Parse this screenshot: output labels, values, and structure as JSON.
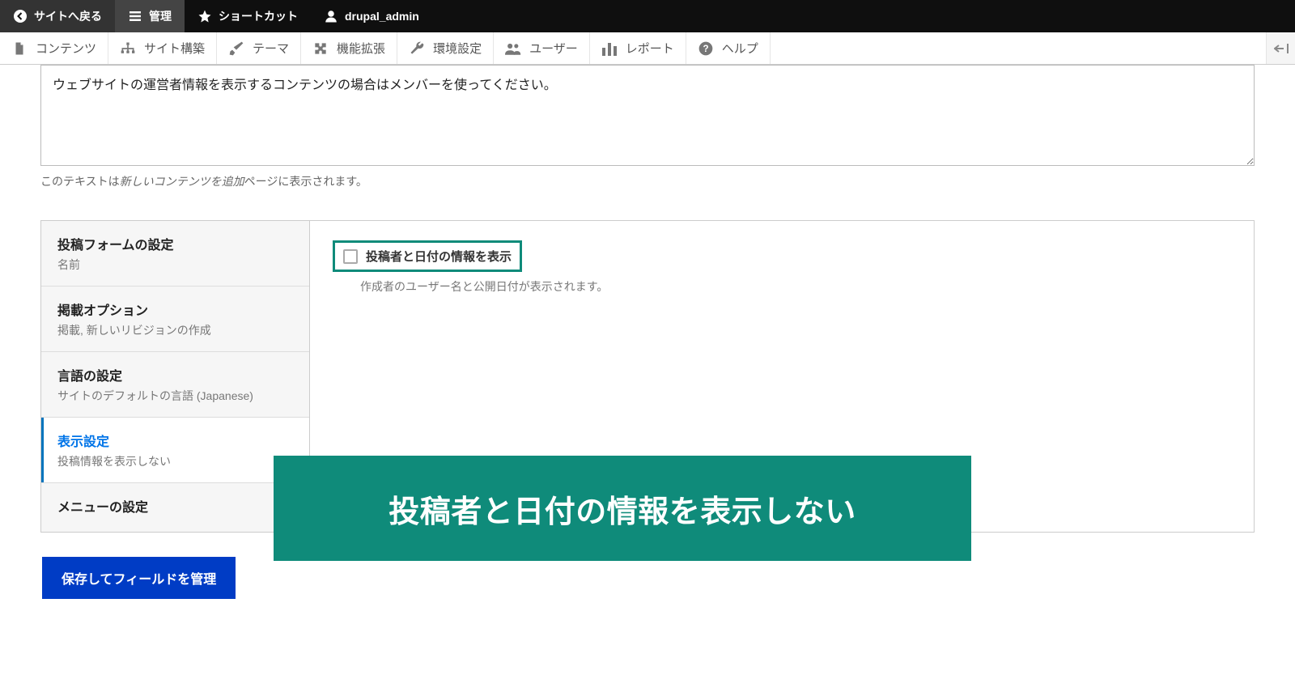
{
  "toolbar": {
    "back_label": "サイトへ戻る",
    "manage_label": "管理",
    "shortcuts_label": "ショートカット",
    "user_label": "drupal_admin"
  },
  "menubar": {
    "items": [
      {
        "label": "コンテンツ"
      },
      {
        "label": "サイト構築"
      },
      {
        "label": "テーマ"
      },
      {
        "label": "機能拡張"
      },
      {
        "label": "環境設定"
      },
      {
        "label": "ユーザー"
      },
      {
        "label": "レポート"
      },
      {
        "label": "ヘルプ"
      }
    ]
  },
  "description": {
    "value": "ウェブサイトの運営者情報を表示するコンテンツの場合はメンバーを使ってください。",
    "help_before": "このテキストは",
    "help_italic": "新しいコンテンツを追加",
    "help_after": "ページに表示されます。"
  },
  "vt": {
    "tabs": [
      {
        "title": "投稿フォームの設定",
        "summary": "名前"
      },
      {
        "title": "掲載オプション",
        "summary": "掲載, 新しいリビジョンの作成"
      },
      {
        "title": "言語の設定",
        "summary": "サイトのデフォルトの言語 (Japanese)"
      },
      {
        "title": "表示設定",
        "summary": "投稿情報を表示しない"
      },
      {
        "title": "メニューの設定",
        "summary": ""
      }
    ],
    "panel": {
      "checkbox_label": "投稿者と日付の情報を表示",
      "checkbox_help": "作成者のユーザー名と公開日付が表示されます。",
      "checkbox_checked": false
    }
  },
  "overlay": {
    "text": "投稿者と日付の情報を表示しない"
  },
  "actions": {
    "save_button": "保存してフィールドを管理"
  }
}
